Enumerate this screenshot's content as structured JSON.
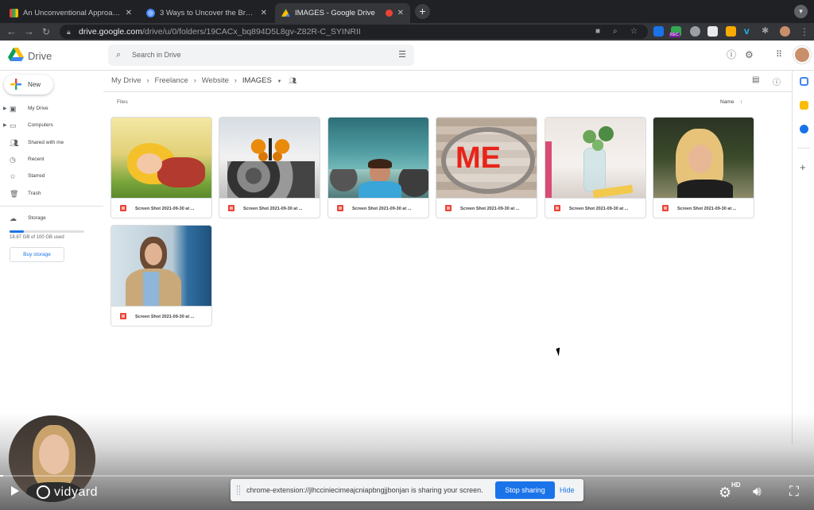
{
  "browser": {
    "tabs": [
      {
        "title": "An Unconventional Approach t",
        "favicon_color": "#e8453c",
        "active": false
      },
      {
        "title": "3 Ways to Uncover the Brand C",
        "favicon_color": "#4285f4",
        "active": false
      },
      {
        "title": "IMAGES - Google Drive",
        "favicon_color": "#fbbc04",
        "active": true
      }
    ],
    "url_host": "drive.google.com",
    "url_path": "/drive/u/0/folders/19CACx_bq894D5L8gv-Z82R-C_SYINRII",
    "rec_badge": "REC"
  },
  "drive": {
    "logo_text": "Drive",
    "search_placeholder": "Search in Drive",
    "new_label": "New",
    "nav": [
      {
        "label": "My Drive",
        "icon": "drive-icon"
      },
      {
        "label": "Computers",
        "icon": "computer-icon"
      },
      {
        "label": "Shared with me",
        "icon": "people-icon"
      },
      {
        "label": "Recent",
        "icon": "clock-icon"
      },
      {
        "label": "Starred",
        "icon": "star-icon"
      },
      {
        "label": "Trash",
        "icon": "trash-icon"
      }
    ],
    "storage_label": "Storage",
    "storage_used": "18.87 GB of 100 GB used",
    "storage_fraction": 0.19,
    "buy_storage": "Buy storage",
    "breadcrumb": [
      "My Drive",
      "Freelance",
      "Website",
      "IMAGES"
    ],
    "files_label": "Files",
    "sort_label": "Name",
    "files": [
      {
        "name": "Screen Shot 2021-09-30 at ...",
        "thumb": "boy-field"
      },
      {
        "name": "Screen Shot 2021-09-30 at ...",
        "thumb": "butterfly-stones"
      },
      {
        "name": "Screen Shot 2021-09-30 at ...",
        "thumb": "boy-rocks"
      },
      {
        "name": "Screen Shot 2021-09-30 at ...",
        "thumb": "me-magnifier"
      },
      {
        "name": "Screen Shot 2021-09-30 at ...",
        "thumb": "desk-plant"
      },
      {
        "name": "Screen Shot 2021-09-30 at ...",
        "thumb": "blonde-woman"
      },
      {
        "name": "Screen Shot 2021-09-30 at ...",
        "thumb": "woman-phone"
      }
    ],
    "me_text": "ME"
  },
  "recorder": {
    "brand": "vidyard",
    "share_message": "chrome-extension://jlhcciniecimeajcniapbngjjbonjan is sharing your screen.",
    "stop_label": "Stop sharing",
    "hide_label": "Hide",
    "hd_label": "HD",
    "progress": 0.004
  }
}
